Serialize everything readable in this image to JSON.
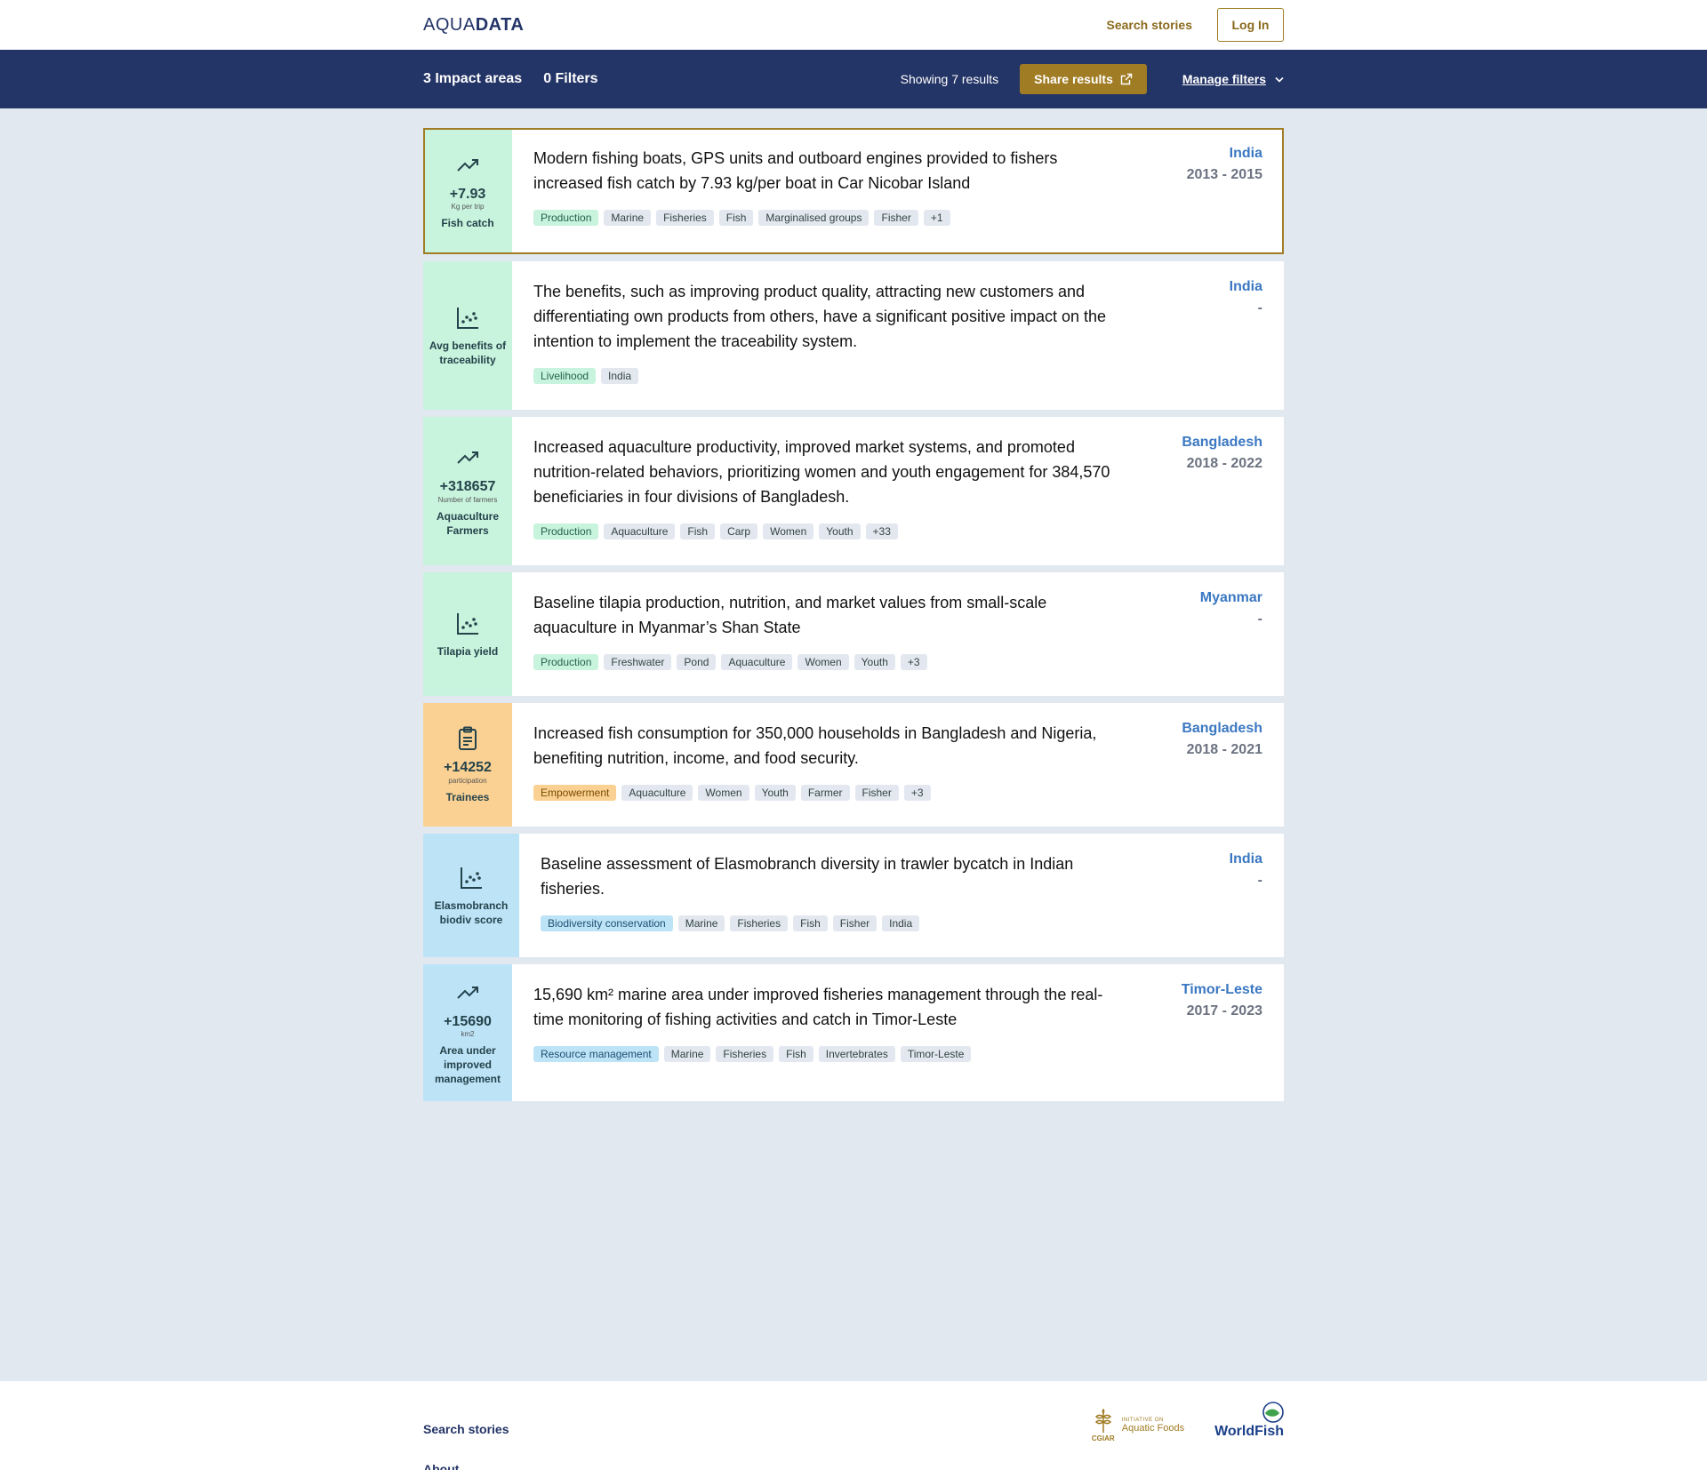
{
  "header": {
    "logo_thin": "AQUA",
    "logo_bold": "DATA",
    "search_label": "Search stories",
    "login_label": "Log In"
  },
  "filterbar": {
    "impact_areas": "3 Impact areas",
    "filters": "0 Filters",
    "showing": "Showing 7 results",
    "share_label": "Share results",
    "manage_label": "Manage filters"
  },
  "cards": [
    {
      "icon": "trend-up-icon",
      "value": "+7.93",
      "unit": "Kg per trip",
      "metric": "Fish catch",
      "title": "Modern fishing boats, GPS units and outboard engines provided to fishers increased fish catch by 7.93 kg/per boat in Car Nicobar Island",
      "tags": [
        "Production",
        "Marine",
        "Fisheries",
        "Fish",
        "Marginalised groups",
        "Fisher",
        "+1"
      ],
      "country": "India",
      "years": "2013 - 2015"
    },
    {
      "icon": "scatter-chart-icon",
      "value": "",
      "unit": "",
      "metric": "Avg benefits of traceability",
      "title": "The benefits, such as improving product quality, attracting new customers and differentiating own products from others, have a significant positive impact on the intention to implement the traceability system.",
      "tags": [
        "Livelihood",
        "India"
      ],
      "country": "India",
      "years": "-"
    },
    {
      "icon": "trend-up-icon",
      "value": "+318657",
      "unit": "Number of farmers",
      "metric": "Aquaculture Farmers",
      "title": "Increased aquaculture productivity, improved market systems, and promoted nutrition-related behaviors, prioritizing women and youth engagement for 384,570 beneficiaries in four divisions of Bangladesh.",
      "tags": [
        "Production",
        "Aquaculture",
        "Fish",
        "Carp",
        "Women",
        "Youth",
        "+33"
      ],
      "country": "Bangladesh",
      "years": "2018 - 2022"
    },
    {
      "icon": "scatter-chart-icon",
      "value": "",
      "unit": "",
      "metric": "Tilapia yield",
      "title": "Baseline tilapia production, nutrition, and market values from small-scale aquaculture in Myanmar’s Shan State",
      "tags": [
        "Production",
        "Freshwater",
        "Pond",
        "Aquaculture",
        "Women",
        "Youth",
        "+3"
      ],
      "country": "Myanmar",
      "years": "-"
    },
    {
      "icon": "clipboard-icon",
      "value": "+14252",
      "unit": "participation",
      "metric": "Trainees",
      "title": "Increased fish consumption for 350,000 households in Bangladesh and Nigeria, benefiting nutrition, income, and food security.",
      "tags": [
        "Empowerment",
        "Aquaculture",
        "Women",
        "Youth",
        "Farmer",
        "Fisher",
        "+3"
      ],
      "country": "Bangladesh",
      "years": "2018 - 2021"
    },
    {
      "icon": "scatter-chart-icon",
      "value": "",
      "unit": "",
      "metric": "Elasmobranch biodiv score",
      "title": "Baseline assessment of Elasmobranch diversity in trawler bycatch in Indian fisheries.",
      "tags": [
        "Biodiversity conservation",
        "Marine",
        "Fisheries",
        "Fish",
        "Fisher",
        "India"
      ],
      "country": "India",
      "years": "-"
    },
    {
      "icon": "trend-up-icon",
      "value": "+15690",
      "unit": "km2",
      "metric": "Area under improved management",
      "title": "15,690 km² marine area under improved fisheries management through the real-time monitoring of fishing activities and catch in Timor-Leste",
      "tags": [
        "Resource management",
        "Marine",
        "Fisheries",
        "Fish",
        "Invertebrates",
        "Timor-Leste"
      ],
      "country": "Timor-Leste",
      "years": "2017 - 2023"
    }
  ],
  "footer": {
    "search_label": "Search stories",
    "about_label": "About",
    "cgiar_small": "INITIATIVE ON",
    "cgiar_big": "Aquatic Foods",
    "cgiar_label": "CGIAR",
    "worldfish_label": "WorldFish"
  },
  "colors": {
    "navy": "#233466",
    "gold": "#a07c24",
    "green": "#c8f3dd",
    "orange": "#fbd193",
    "blue": "#bde3f7",
    "link_blue": "#3b78c2"
  }
}
